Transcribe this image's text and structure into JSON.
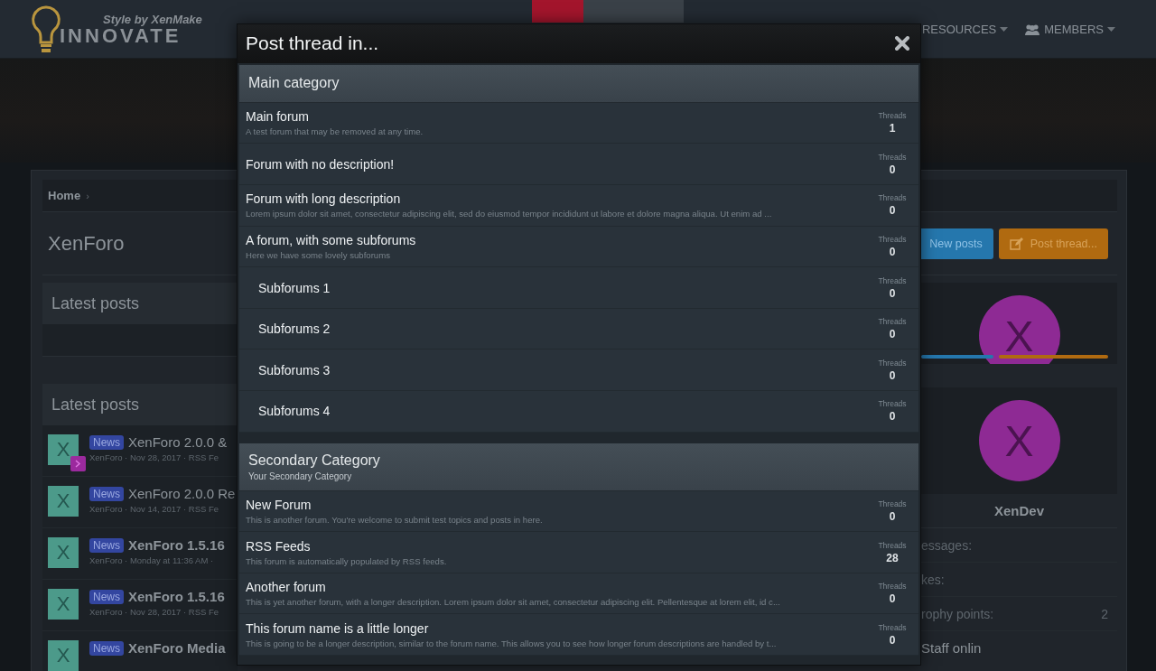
{
  "header": {
    "logo": {
      "tagline": "Style by XenMake",
      "name": "INNOVATE"
    },
    "nav": [
      {
        "label": "RESOURCES",
        "kind": "text"
      },
      {
        "label": "MEMBERS",
        "kind": "icon"
      }
    ]
  },
  "breadcrumb": [
    {
      "label": "Home",
      "separator": "›"
    }
  ],
  "page_title": "XenForo",
  "actions": [
    {
      "label": "New posts",
      "kind": "secondary"
    },
    {
      "label": "Post thread...",
      "kind": "primary"
    }
  ],
  "left_blocks": [
    {
      "title": "Latest posts"
    },
    {
      "title": "Latest posts",
      "posts": [
        {
          "avatar": "X",
          "badge": "News",
          "title": "XenForo 2.0.0 &",
          "unread": false,
          "new_marker": true,
          "meta": "XenForo · Nov 28, 2017 · RSS Fe"
        },
        {
          "avatar": "X",
          "badge": "News",
          "title": "XenForo 2.0.0 Re",
          "unread": false,
          "new_marker": false,
          "meta": "XenForo · Nov 14, 2017 · RSS Fe"
        },
        {
          "avatar": "X",
          "badge": "News",
          "title": "XenForo 1.5.16",
          "unread": true,
          "new_marker": false,
          "meta": "XenForo · Monday at 11:36 AM ·"
        },
        {
          "avatar": "X",
          "badge": "News",
          "title": "XenForo 1.5.16",
          "unread": true,
          "new_marker": false,
          "meta": "XenForo · Nov 28, 2017 · RSS Fe"
        },
        {
          "avatar": "X",
          "badge": "News",
          "title": "XenForo Media",
          "unread": true,
          "new_marker": false
        }
      ]
    }
  ],
  "sidebar": {
    "top_card": {
      "avatar": "X"
    },
    "profile": {
      "avatar": "X",
      "name": "XenDev",
      "stats": [
        {
          "label": "essages:"
        },
        {
          "label": "kes:"
        },
        {
          "label": "rophy points:",
          "value": "2"
        }
      ]
    },
    "staff_heading": "Staff onlin"
  },
  "modal": {
    "title": "Post thread in...",
    "categories": [
      {
        "title": "Main category",
        "forums": [
          {
            "name": "Main forum",
            "description": "A test forum that may be removed at any time.",
            "stat_label": "Threads",
            "count": "1"
          },
          {
            "name": "Forum with no description!",
            "stat_label": "Threads",
            "count": "0"
          },
          {
            "name": "Forum with long description",
            "description": "Lorem ipsum dolor sit amet, consectetur adipiscing elit, sed do eiusmod tempor incididunt ut labore et dolore magna aliqua. Ut enim ad ...",
            "stat_label": "Threads",
            "count": "0"
          },
          {
            "name": "A forum, with some subforums",
            "description": "Here we have some lovely subforums",
            "stat_label": "Threads",
            "count": "0",
            "children": [
              {
                "name": "Subforums 1",
                "stat_label": "Threads",
                "count": "0"
              },
              {
                "name": "Subforums 2",
                "stat_label": "Threads",
                "count": "0"
              },
              {
                "name": "Subforums 3",
                "stat_label": "Threads",
                "count": "0"
              },
              {
                "name": "Subforums 4",
                "stat_label": "Threads",
                "count": "0"
              }
            ]
          }
        ]
      },
      {
        "title": "Secondary Category",
        "description": "Your Secondary Category",
        "forums": [
          {
            "name": "New Forum",
            "description": "This is another forum. You're welcome to submit test topics and posts in here.",
            "stat_label": "Threads",
            "count": "0"
          },
          {
            "name": "RSS Feeds",
            "description": "This forum is automatically populated by RSS feeds.",
            "stat_label": "Threads",
            "count": "28"
          },
          {
            "name": "Another forum",
            "description": "This is yet another forum, with a longer description. Lorem ipsum dolor sit amet, consectetur adipiscing elit. Pellentesque at lorem elit, id c...",
            "stat_label": "Threads",
            "count": "0"
          },
          {
            "name": "This forum name is a little longer",
            "description": "This is going to be a longer description, similar to the forum name. This allows you to see how longer forum descriptions are handled by t...",
            "stat_label": "Threads",
            "count": "0"
          }
        ]
      }
    ]
  }
}
